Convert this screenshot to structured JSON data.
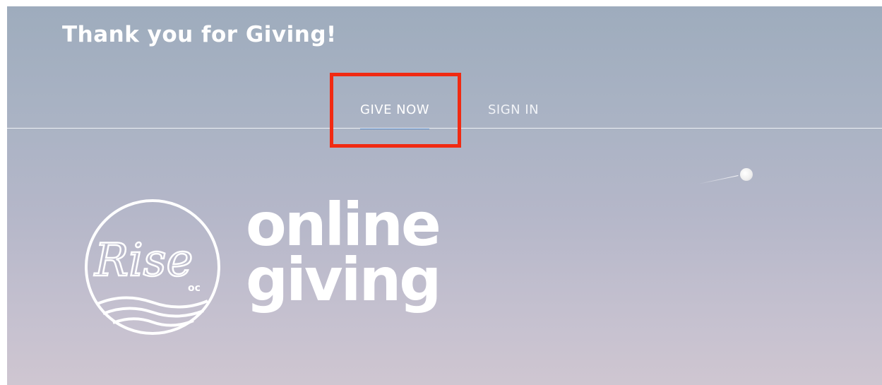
{
  "header": {
    "title": "Thank you for Giving!"
  },
  "nav": {
    "tabs": [
      {
        "label": "GIVE NOW",
        "active": true
      },
      {
        "label": "SIGN IN",
        "active": false
      }
    ]
  },
  "logo": {
    "script_text": "Rise",
    "sub_text": "oc",
    "line1": "online",
    "line2": "giving"
  },
  "colors": {
    "highlight_border": "#f12a12",
    "active_tab_underline": "#4e82c0",
    "text": "#ffffff"
  }
}
